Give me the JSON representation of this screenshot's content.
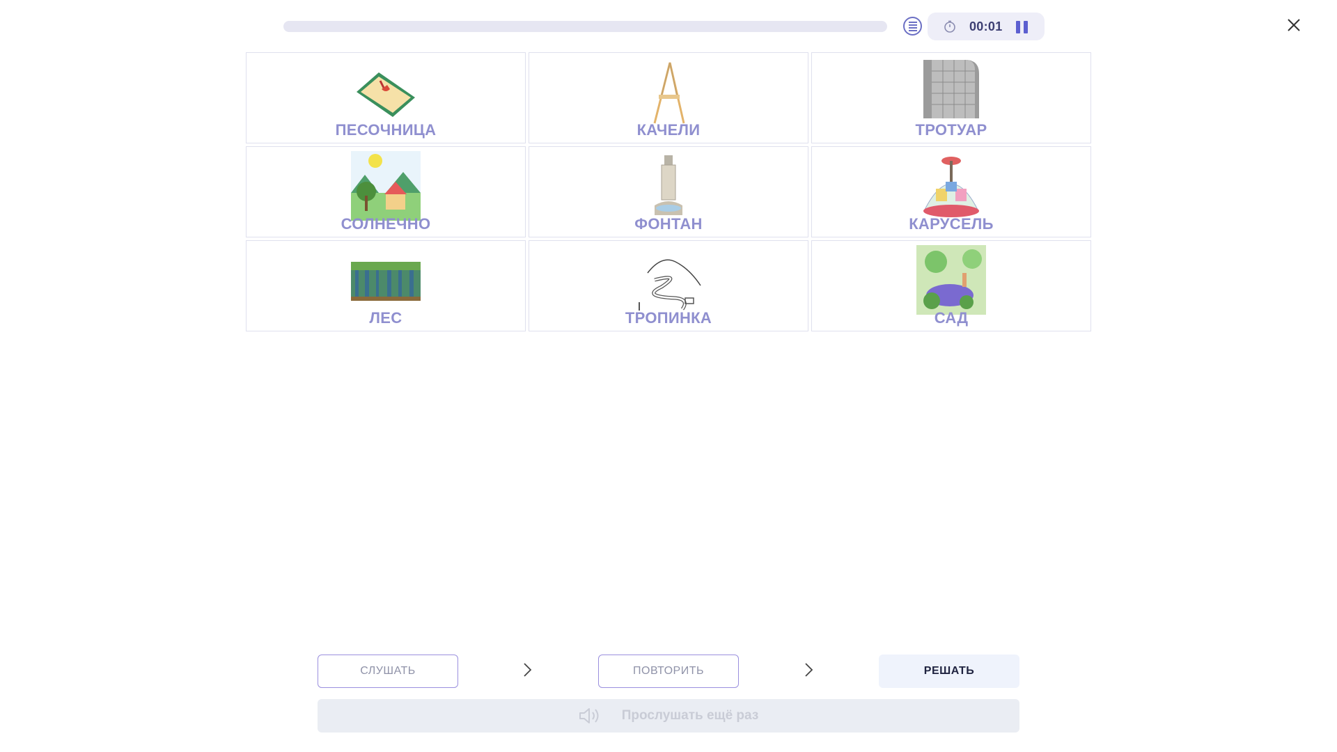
{
  "header": {
    "timer": "00:01",
    "progress": 0
  },
  "cards": [
    {
      "label": "ПЕСОЧНИЦА",
      "icon": "sandbox-image"
    },
    {
      "label": "КАЧЕЛИ",
      "icon": "swing-image"
    },
    {
      "label": "ТРОТУАР",
      "icon": "sidewalk-image"
    },
    {
      "label": "СОЛНЕЧНО",
      "icon": "sunny-image"
    },
    {
      "label": "ФОНТАН",
      "icon": "fountain-image"
    },
    {
      "label": "КАРУСЕЛЬ",
      "icon": "carousel-image"
    },
    {
      "label": "ЛЕС",
      "icon": "forest-image"
    },
    {
      "label": "ТРОПИНКА",
      "icon": "path-image"
    },
    {
      "label": "САД",
      "icon": "garden-image"
    }
  ],
  "controls": {
    "listen": "СЛУШАТЬ",
    "repeat": "ПОВТОРИТЬ",
    "solve": "РЕШАТЬ",
    "replay": "Прослушать ещё раз"
  },
  "colors": {
    "accent": "#5c5fd0",
    "label": "#8f8fcf",
    "card_border": "#dfe0ee"
  }
}
